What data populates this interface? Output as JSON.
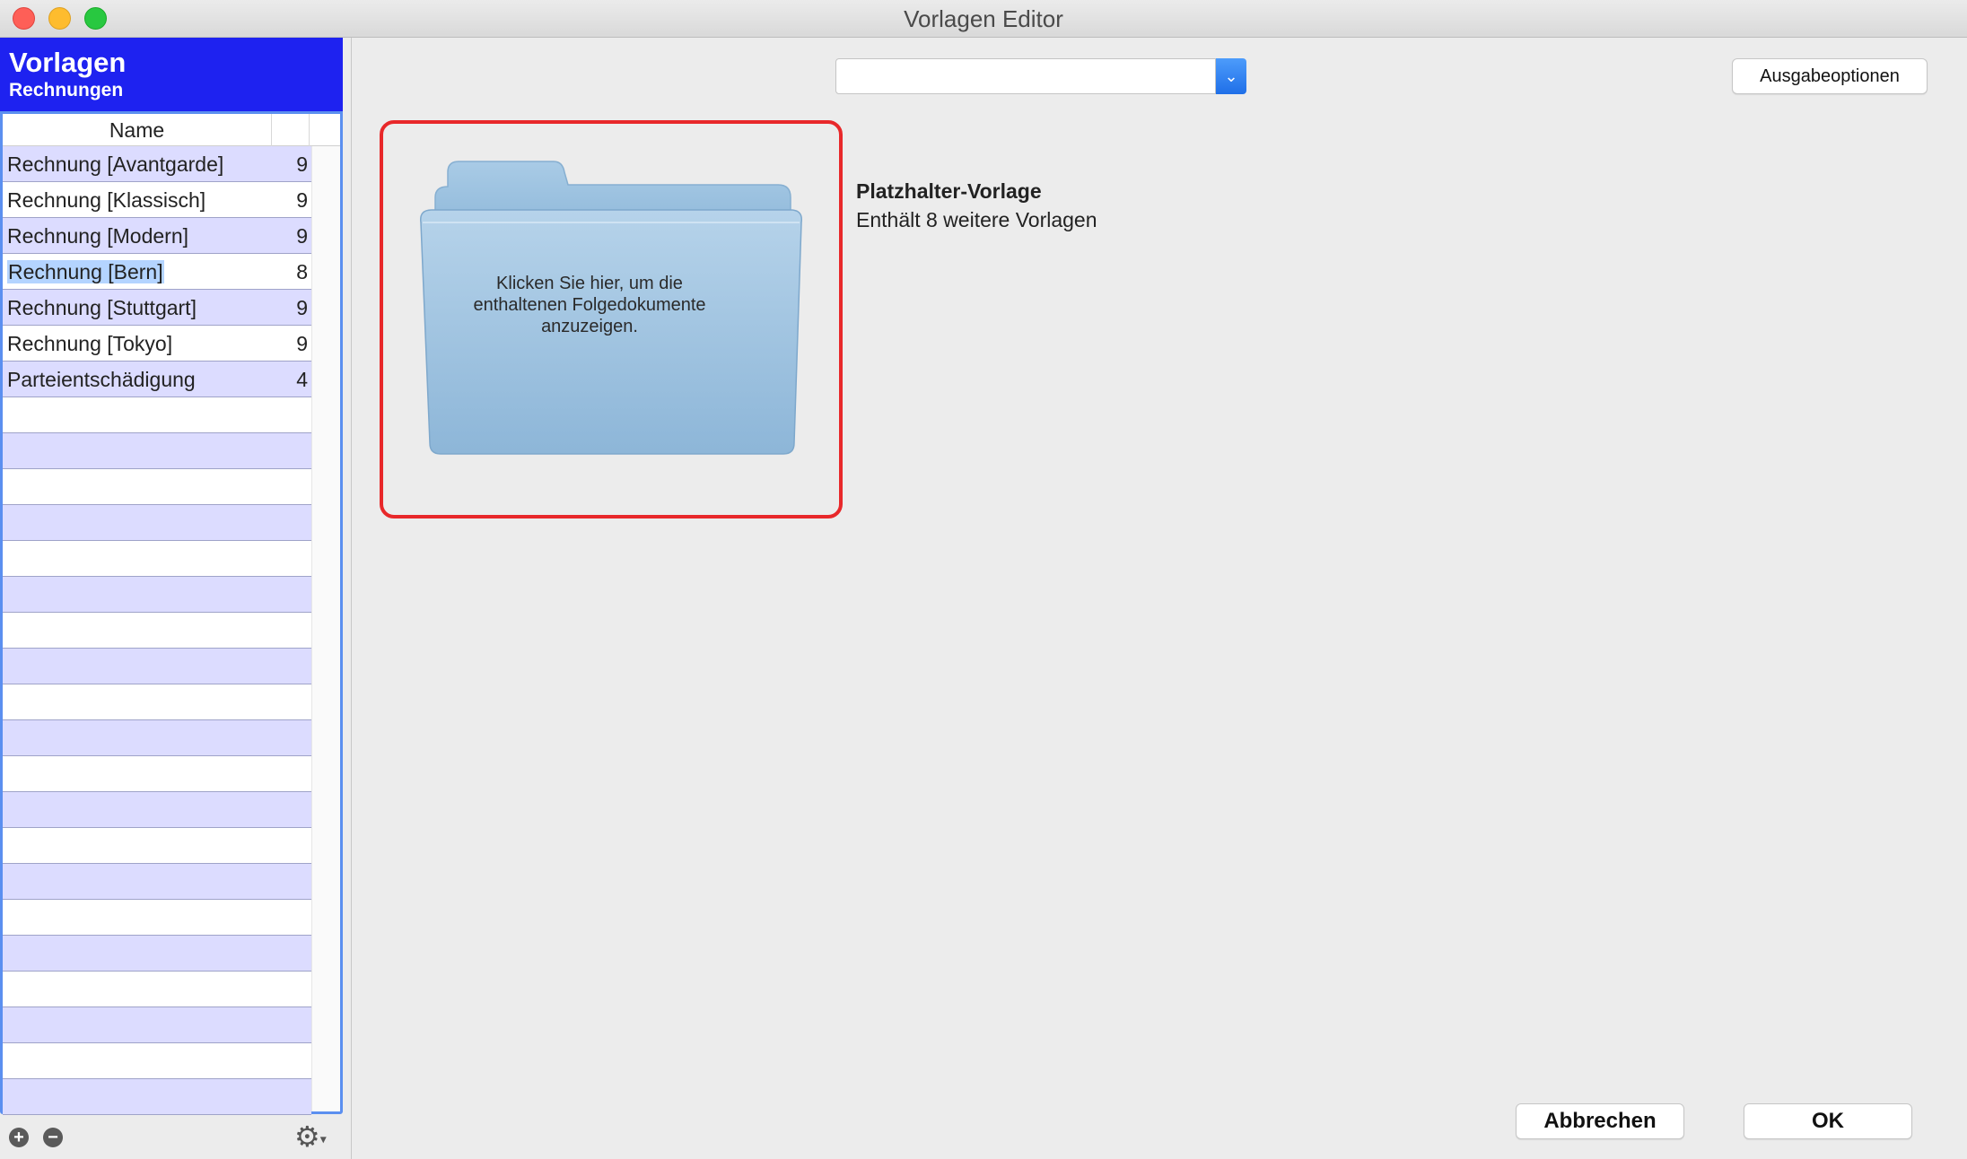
{
  "window": {
    "title": "Vorlagen Editor"
  },
  "sidebar": {
    "title": "Vorlagen",
    "subtitle": "Rechnungen",
    "column_name": "Name",
    "items": [
      {
        "name": "Rechnung [Avantgarde]",
        "count": "9"
      },
      {
        "name": "Rechnung [Klassisch]",
        "count": "9"
      },
      {
        "name": "Rechnung [Modern]",
        "count": "9"
      },
      {
        "name": "Rechnung [Bern]",
        "count": "8",
        "selected": true
      },
      {
        "name": "Rechnung [Stuttgart]",
        "count": "9"
      },
      {
        "name": "Rechnung [Tokyo]",
        "count": "9"
      },
      {
        "name": "Parteientschädigung",
        "count": "4"
      }
    ],
    "add_label": "+",
    "remove_label": "−"
  },
  "toolbar": {
    "combo_value": "",
    "output_options_label": "Ausgabeoptionen"
  },
  "preview": {
    "folder_text": "Klicken Sie hier, um die enthaltenen Folgedokumente anzuzeigen.",
    "title": "Platzhalter-Vorlage",
    "subtitle": "Enthält 8 weitere Vorlagen"
  },
  "footer": {
    "cancel_label": "Abbrechen",
    "ok_label": "OK"
  },
  "colors": {
    "header_blue": "#1e22f0",
    "row_odd": "#dcdcff",
    "selection": "#b4d4ff",
    "highlight_red": "#e8282a",
    "folder_blue": "#9cc0dd"
  }
}
